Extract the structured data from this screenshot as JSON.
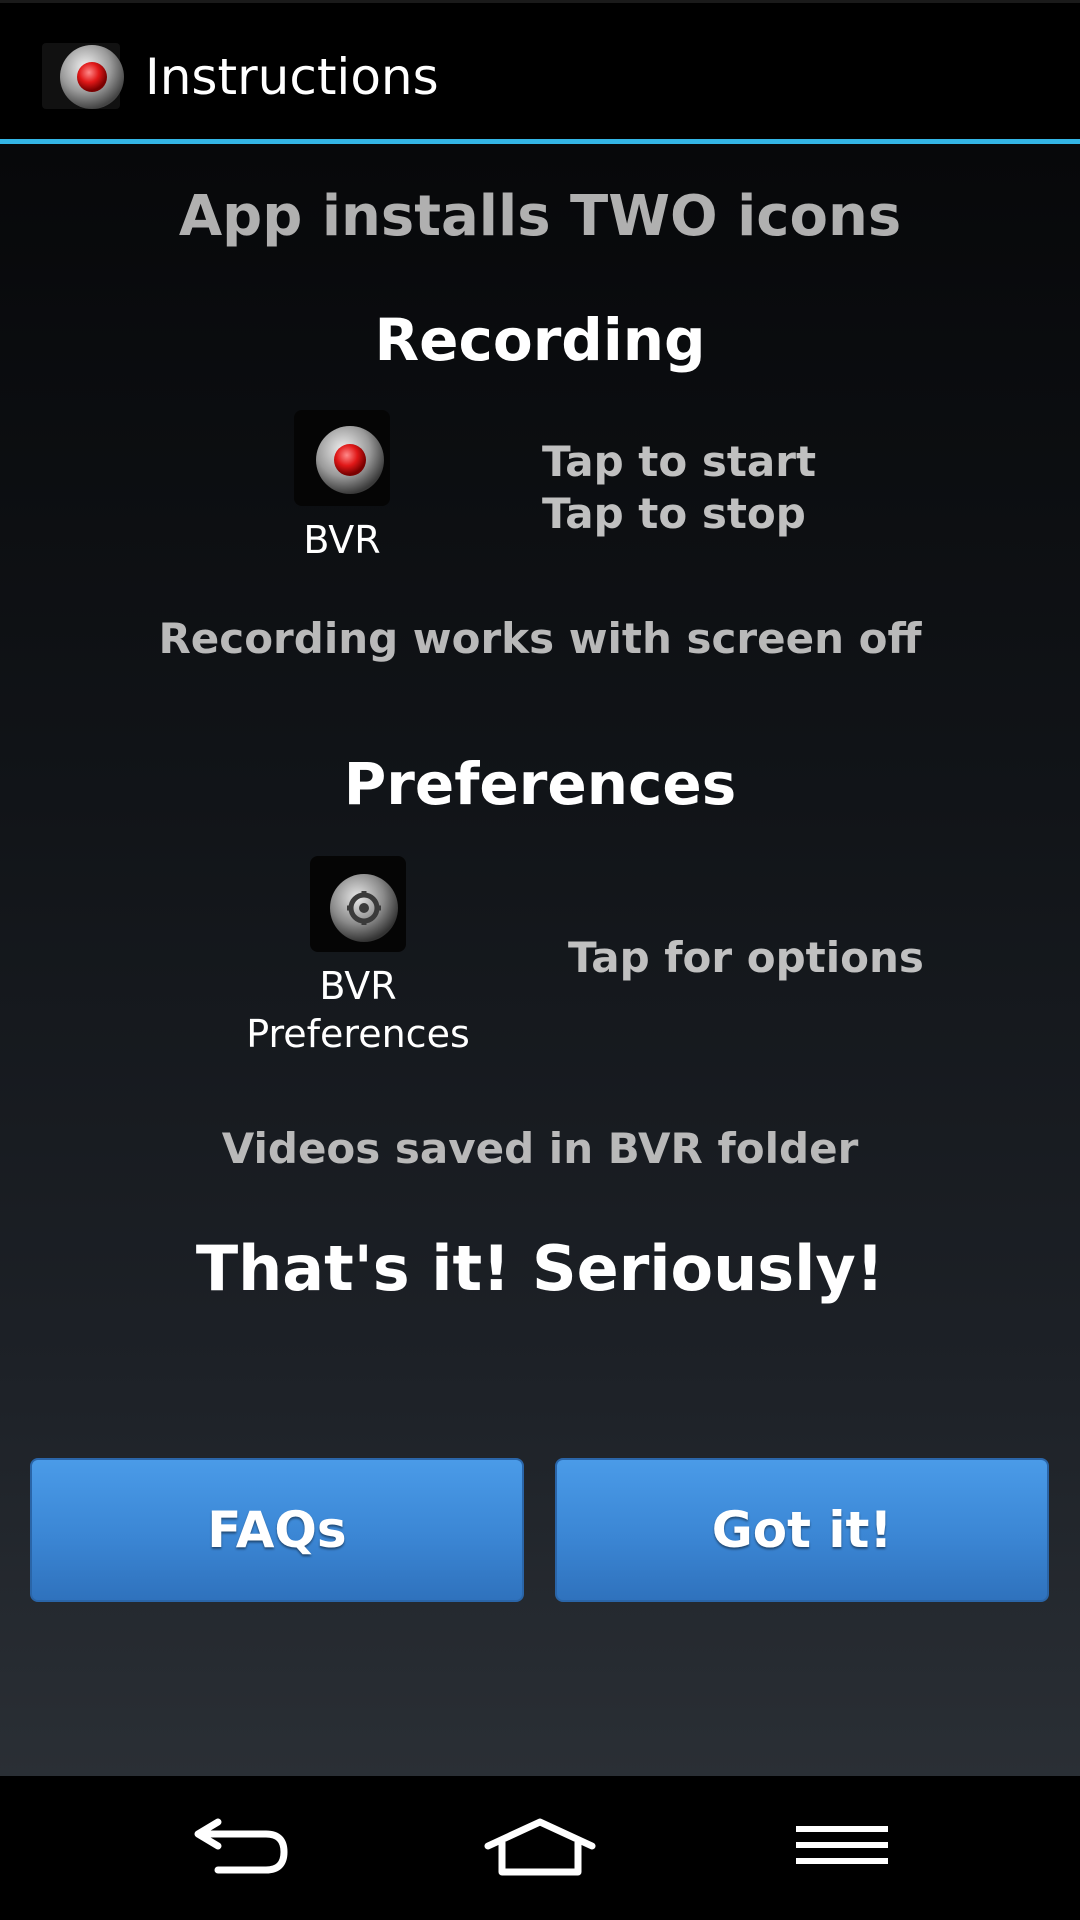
{
  "action_bar": {
    "title": "Instructions",
    "icon": "record-button-icon"
  },
  "content": {
    "headline": "App installs TWO icons",
    "recording": {
      "title": "Recording",
      "launcher_label": "BVR",
      "launcher_icon": "record-button-icon",
      "hint_line1": "Tap to start",
      "hint_line2": "Tap to stop",
      "note": "Recording works with screen off"
    },
    "preferences": {
      "title": "Preferences",
      "launcher_label_line1": "BVR",
      "launcher_label_line2": "Preferences",
      "launcher_icon": "preferences-gear-icon",
      "hint": "Tap for options",
      "note": "Videos saved in BVR folder"
    },
    "final": "That's it! Seriously!"
  },
  "buttons": {
    "faqs_label": "FAQs",
    "got_it_label": "Got it!"
  },
  "nav_bar": {
    "back_icon": "back-icon",
    "home_icon": "home-icon",
    "menu_icon": "menu-icon"
  },
  "colors": {
    "accent": "#33b5e5",
    "button": "#3b86d4",
    "record_red": "#e02020"
  }
}
